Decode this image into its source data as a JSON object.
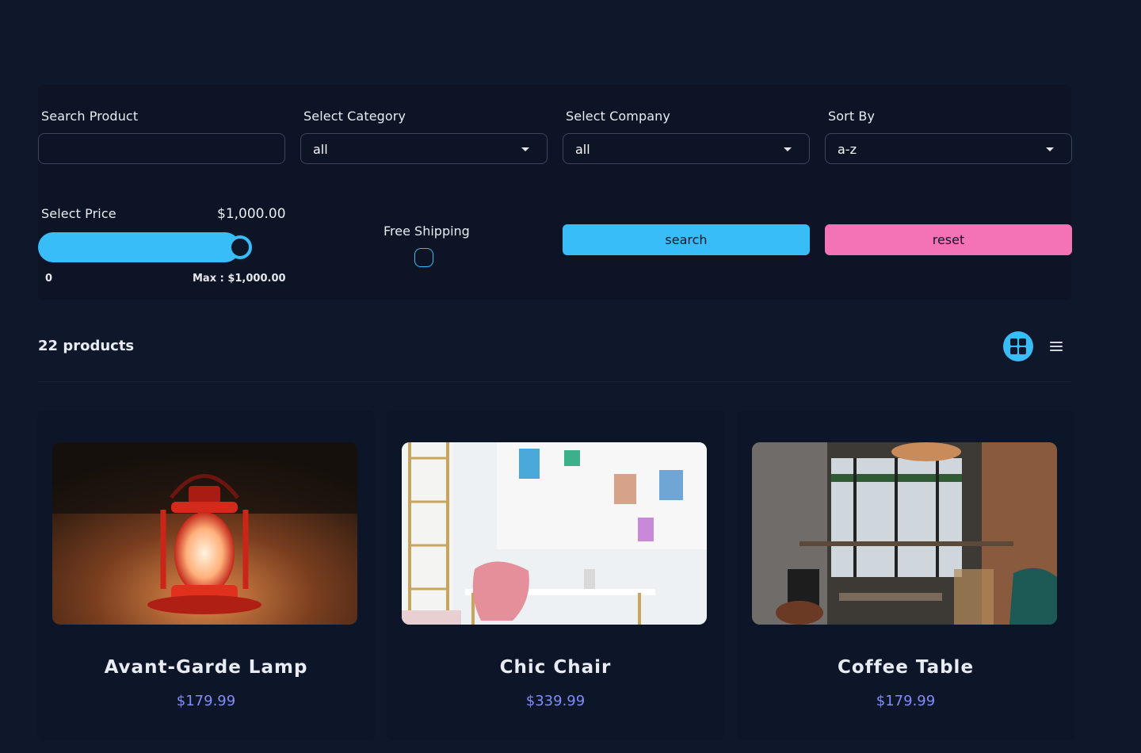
{
  "filters": {
    "search": {
      "label": "Search Product",
      "value": ""
    },
    "category": {
      "label": "Select Category",
      "value": "all"
    },
    "company": {
      "label": "Select Company",
      "value": "all"
    },
    "sort": {
      "label": "Sort By",
      "value": "a-z"
    },
    "price": {
      "label": "Select Price",
      "value_display": "$1,000.00",
      "min_label": "0",
      "max_label": "Max : $1,000.00",
      "fill_fraction": 1.0
    },
    "shipping": {
      "label": "Free Shipping",
      "checked": false
    },
    "search_button": "search",
    "reset_button": "reset"
  },
  "products_header": {
    "count_text": "22 products",
    "active_view": "grid",
    "icons": [
      "grid-view-icon",
      "list-view-icon"
    ]
  },
  "products": [
    {
      "name": "Avant-Garde Lamp",
      "price": "$179.99",
      "image": "red-lantern-on-sand-photo"
    },
    {
      "name": "Chic Chair",
      "price": "$339.99",
      "image": "white-desk-pink-chair-photo"
    },
    {
      "name": "Coffee Table",
      "price": "$179.99",
      "image": "cafe-interior-tables-photo"
    }
  ],
  "colors": {
    "background": "#0f172a",
    "primary": "#38bdf8",
    "secondary": "#f472b6",
    "price": "#818cf8"
  }
}
